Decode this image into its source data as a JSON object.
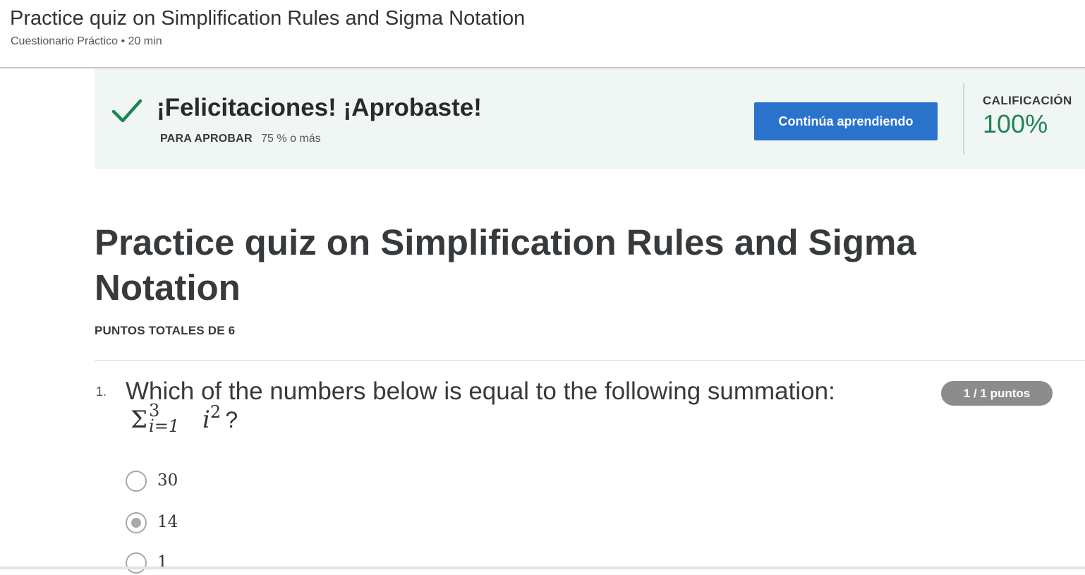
{
  "header": {
    "title": "Practice quiz on Simplification Rules and Sigma Notation",
    "subtitle": "Cuestionario Práctico • 20 min"
  },
  "result_banner": {
    "icon": "checkmark-icon",
    "headline": "¡Felicitaciones! ¡Aprobaste!",
    "pass_label": "PARA APROBAR",
    "pass_value": "75 % o más",
    "continue_label": "Continúa aprendiendo",
    "grade_label": "CALIFICACIÓN",
    "grade_value": "100%"
  },
  "quiz": {
    "title": "Practice quiz on Simplification Rules and Sigma Notation",
    "total_points": "PUNTOS TOTALES DE 6"
  },
  "question_1": {
    "number": "1.",
    "text": "Which of the numbers below is equal to the following summation:",
    "math": {
      "symbol": "Σ",
      "upper": "3",
      "lower": "i=1",
      "variable": "i",
      "exponent": "2",
      "end": "?"
    },
    "points": "1 / 1 puntos",
    "options": [
      {
        "label": "30",
        "selected": false
      },
      {
        "label": "14",
        "selected": true
      },
      {
        "label": "1",
        "selected": false
      }
    ]
  },
  "colors": {
    "accent_blue": "#2a73cc",
    "success_green": "#1f8354",
    "banner_bg": "#f0f6f4",
    "badge_gray": "#8c8c8c"
  }
}
